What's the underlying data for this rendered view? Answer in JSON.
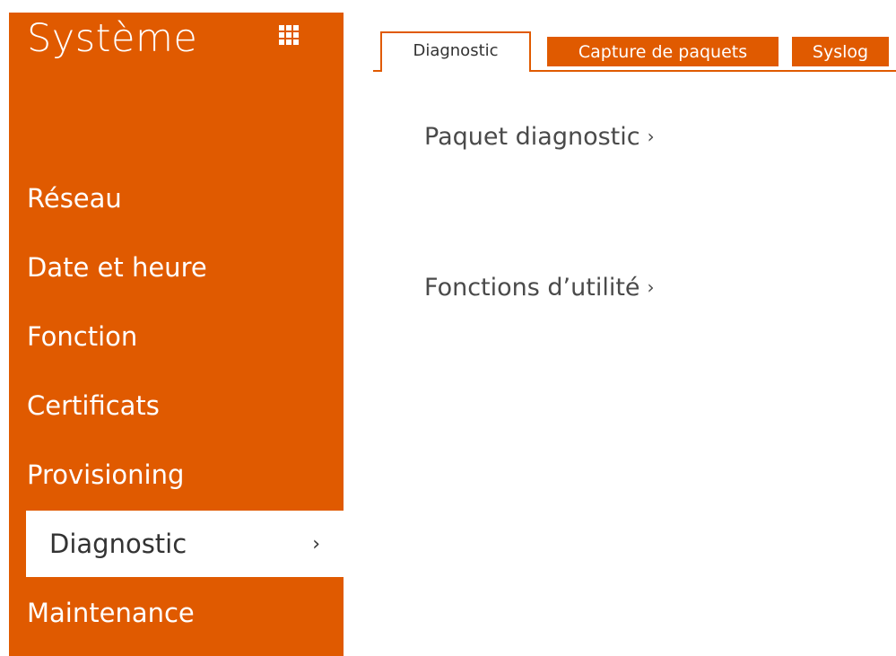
{
  "sidebar": {
    "title": "Système",
    "grid_icon": "grid-icon",
    "items": [
      {
        "label": "Réseau",
        "active": false
      },
      {
        "label": "Date et heure",
        "active": false
      },
      {
        "label": "Fonction",
        "active": false
      },
      {
        "label": "Certificats",
        "active": false
      },
      {
        "label": "Provisioning",
        "active": false
      },
      {
        "label": "Diagnostic",
        "active": true,
        "chevron": "›"
      },
      {
        "label": "Maintenance",
        "active": false
      }
    ]
  },
  "tabs": [
    {
      "label": "Diagnostic",
      "active": true
    },
    {
      "label": "Capture de paquets",
      "active": false
    },
    {
      "label": "Syslog",
      "active": false
    }
  ],
  "main": {
    "links": [
      {
        "label": "Paquet diagnostic",
        "chevron": "›"
      },
      {
        "label": "Fonctions d’utilité",
        "chevron": "›"
      }
    ]
  },
  "colors": {
    "accent": "#e05a00",
    "text_dark": "#333333",
    "background": "#ffffff"
  }
}
